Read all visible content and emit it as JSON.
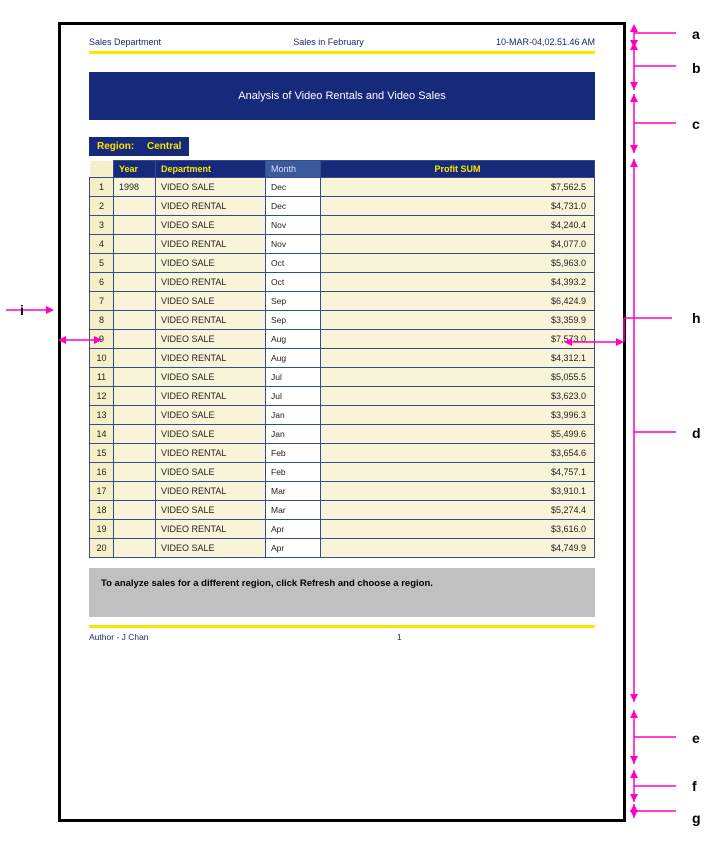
{
  "header": {
    "left": "Sales Department",
    "center": "Sales in February",
    "right": "10-MAR-04,02.51.46 AM"
  },
  "title": "Analysis of Video Rentals and Video Sales",
  "region": {
    "label": "Region:",
    "value": "Central"
  },
  "columns": {
    "year": "Year",
    "dept": "Department",
    "month": "Month",
    "profit": "Profit SUM"
  },
  "rows": [
    {
      "n": "1",
      "year": "1998",
      "dept": "VIDEO SALE",
      "month": "Dec",
      "profit": "$7,562.5"
    },
    {
      "n": "2",
      "year": "",
      "dept": "VIDEO RENTAL",
      "month": "Dec",
      "profit": "$4,731.0"
    },
    {
      "n": "3",
      "year": "",
      "dept": "VIDEO SALE",
      "month": "Nov",
      "profit": "$4,240.4"
    },
    {
      "n": "4",
      "year": "",
      "dept": "VIDEO RENTAL",
      "month": "Nov",
      "profit": "$4,077.0"
    },
    {
      "n": "5",
      "year": "",
      "dept": "VIDEO SALE",
      "month": "Oct",
      "profit": "$5,963.0"
    },
    {
      "n": "6",
      "year": "",
      "dept": "VIDEO RENTAL",
      "month": "Oct",
      "profit": "$4,393.2"
    },
    {
      "n": "7",
      "year": "",
      "dept": "VIDEO SALE",
      "month": "Sep",
      "profit": "$6,424.9"
    },
    {
      "n": "8",
      "year": "",
      "dept": "VIDEO RENTAL",
      "month": "Sep",
      "profit": "$3,359.9"
    },
    {
      "n": "9",
      "year": "",
      "dept": "VIDEO SALE",
      "month": "Aug",
      "profit": "$7,573.0"
    },
    {
      "n": "10",
      "year": "",
      "dept": "VIDEO RENTAL",
      "month": "Aug",
      "profit": "$4,312.1"
    },
    {
      "n": "11",
      "year": "",
      "dept": "VIDEO SALE",
      "month": "Jul",
      "profit": "$5,055.5"
    },
    {
      "n": "12",
      "year": "",
      "dept": "VIDEO RENTAL",
      "month": "Jul",
      "profit": "$3,623.0"
    },
    {
      "n": "13",
      "year": "",
      "dept": "VIDEO SALE",
      "month": "Jan",
      "profit": "$3,996.3"
    },
    {
      "n": "14",
      "year": "",
      "dept": "VIDEO SALE",
      "month": "Jan",
      "profit": "$5,499.6"
    },
    {
      "n": "15",
      "year": "",
      "dept": "VIDEO RENTAL",
      "month": "Feb",
      "profit": "$3,654.6"
    },
    {
      "n": "16",
      "year": "",
      "dept": "VIDEO SALE",
      "month": "Feb",
      "profit": "$4,757.1"
    },
    {
      "n": "17",
      "year": "",
      "dept": "VIDEO RENTAL",
      "month": "Mar",
      "profit": "$3,910.1"
    },
    {
      "n": "18",
      "year": "",
      "dept": "VIDEO SALE",
      "month": "Mar",
      "profit": "$5,274.4"
    },
    {
      "n": "19",
      "year": "",
      "dept": "VIDEO RENTAL",
      "month": "Apr",
      "profit": "$3,616.0"
    },
    {
      "n": "20",
      "year": "",
      "dept": "VIDEO SALE",
      "month": "Apr",
      "profit": "$4,749.9"
    }
  ],
  "note": "To analyze sales for a different region, click Refresh and choose a region.",
  "footer": {
    "author": "Author - J Chan",
    "page": "1"
  },
  "annotations": {
    "a": "a",
    "b": "b",
    "c": "c",
    "d": "d",
    "e": "e",
    "f": "f",
    "g": "g",
    "h": "h",
    "i": "i"
  }
}
